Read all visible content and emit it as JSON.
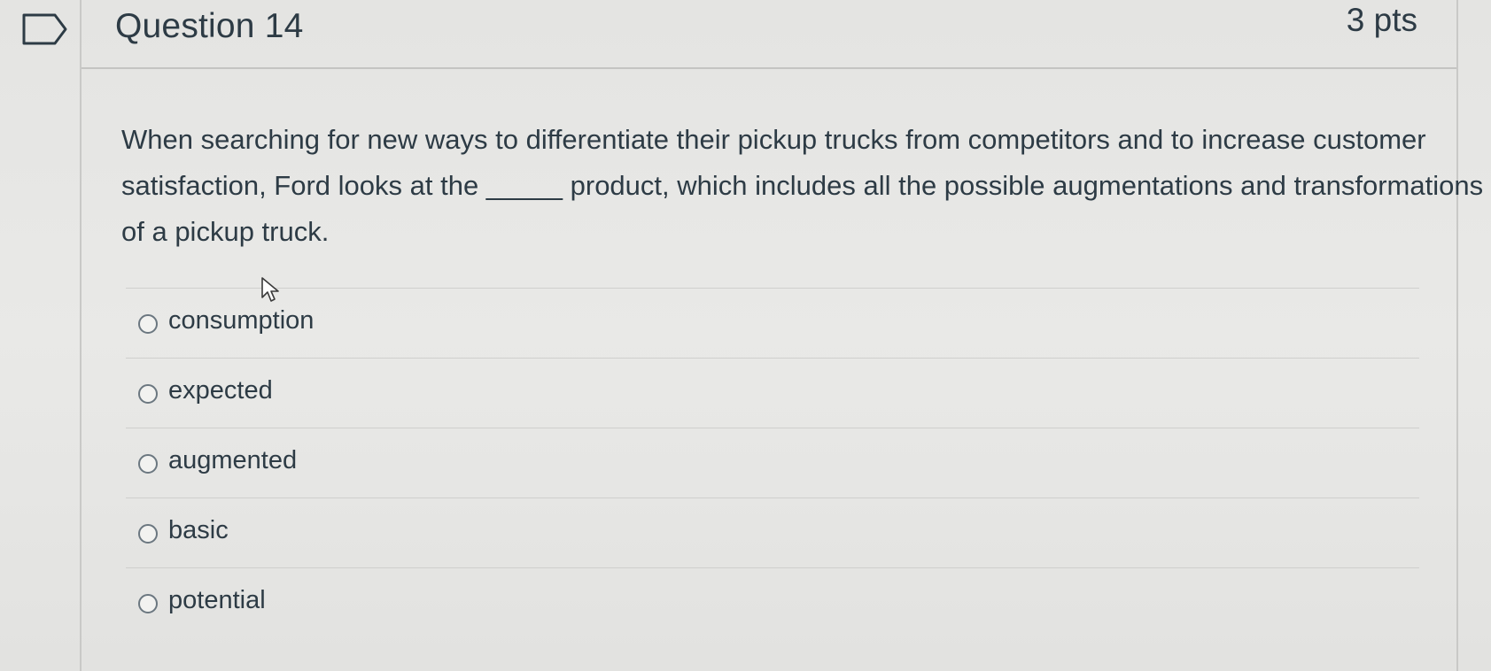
{
  "question": {
    "title": "Question 14",
    "points": "3 pts",
    "text": "When searching for new ways to differentiate their pickup trucks from competitors and to increase customer satisfaction, Ford looks at the _____ product, which includes all the possible augmentations and transformations of a pickup truck."
  },
  "answers": [
    {
      "label": "consumption"
    },
    {
      "label": "expected"
    },
    {
      "label": "augmented"
    },
    {
      "label": "basic"
    },
    {
      "label": "potential"
    }
  ],
  "icons": {
    "flag": "flag-icon",
    "cursor": "mouse-pointer-icon"
  }
}
